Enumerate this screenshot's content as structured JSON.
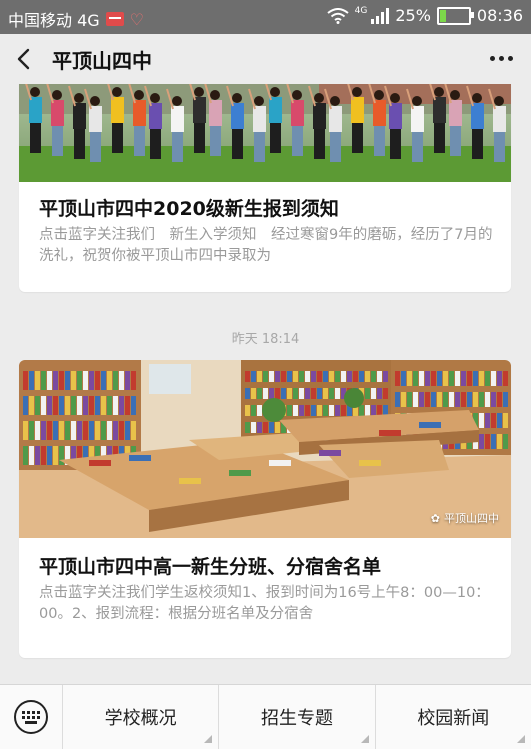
{
  "status_bar": {
    "carrier": "中国移动 4G",
    "network": "4G",
    "battery_percent": "25%",
    "battery_level": 0.25,
    "time": "08:36"
  },
  "header": {
    "title": "平顶山四中",
    "back_icon": "chevron-left-icon",
    "more_icon": "more-dots-icon"
  },
  "articles": [
    {
      "title": "平顶山市四中2020级新生报到须知",
      "digest": "点击蓝字关注我们　新生入学须知　经过寒窗9年的磨砺，经历了7月的洗礼，祝贺你被平顶山市四中录取为"
    },
    {
      "title": "平顶山市四中高一新生分班、分宿舍名单",
      "digest": "点击蓝字关注我们学生返校须知1、报到时间为16号上午8：00—10：00。2、报到流程：根据分班名单及分宿舍",
      "watermark": "平顶山四中"
    }
  ],
  "timestamp": "昨天 18:14",
  "bottom_menu": {
    "keyboard_icon": "keyboard-icon",
    "items": [
      {
        "label": "学校概况"
      },
      {
        "label": "招生专题"
      },
      {
        "label": "校园新闻"
      }
    ]
  },
  "colors": {
    "status_bar": "#6e6e6e",
    "background": "#ececec",
    "battery_fill": "#7cd84a"
  }
}
